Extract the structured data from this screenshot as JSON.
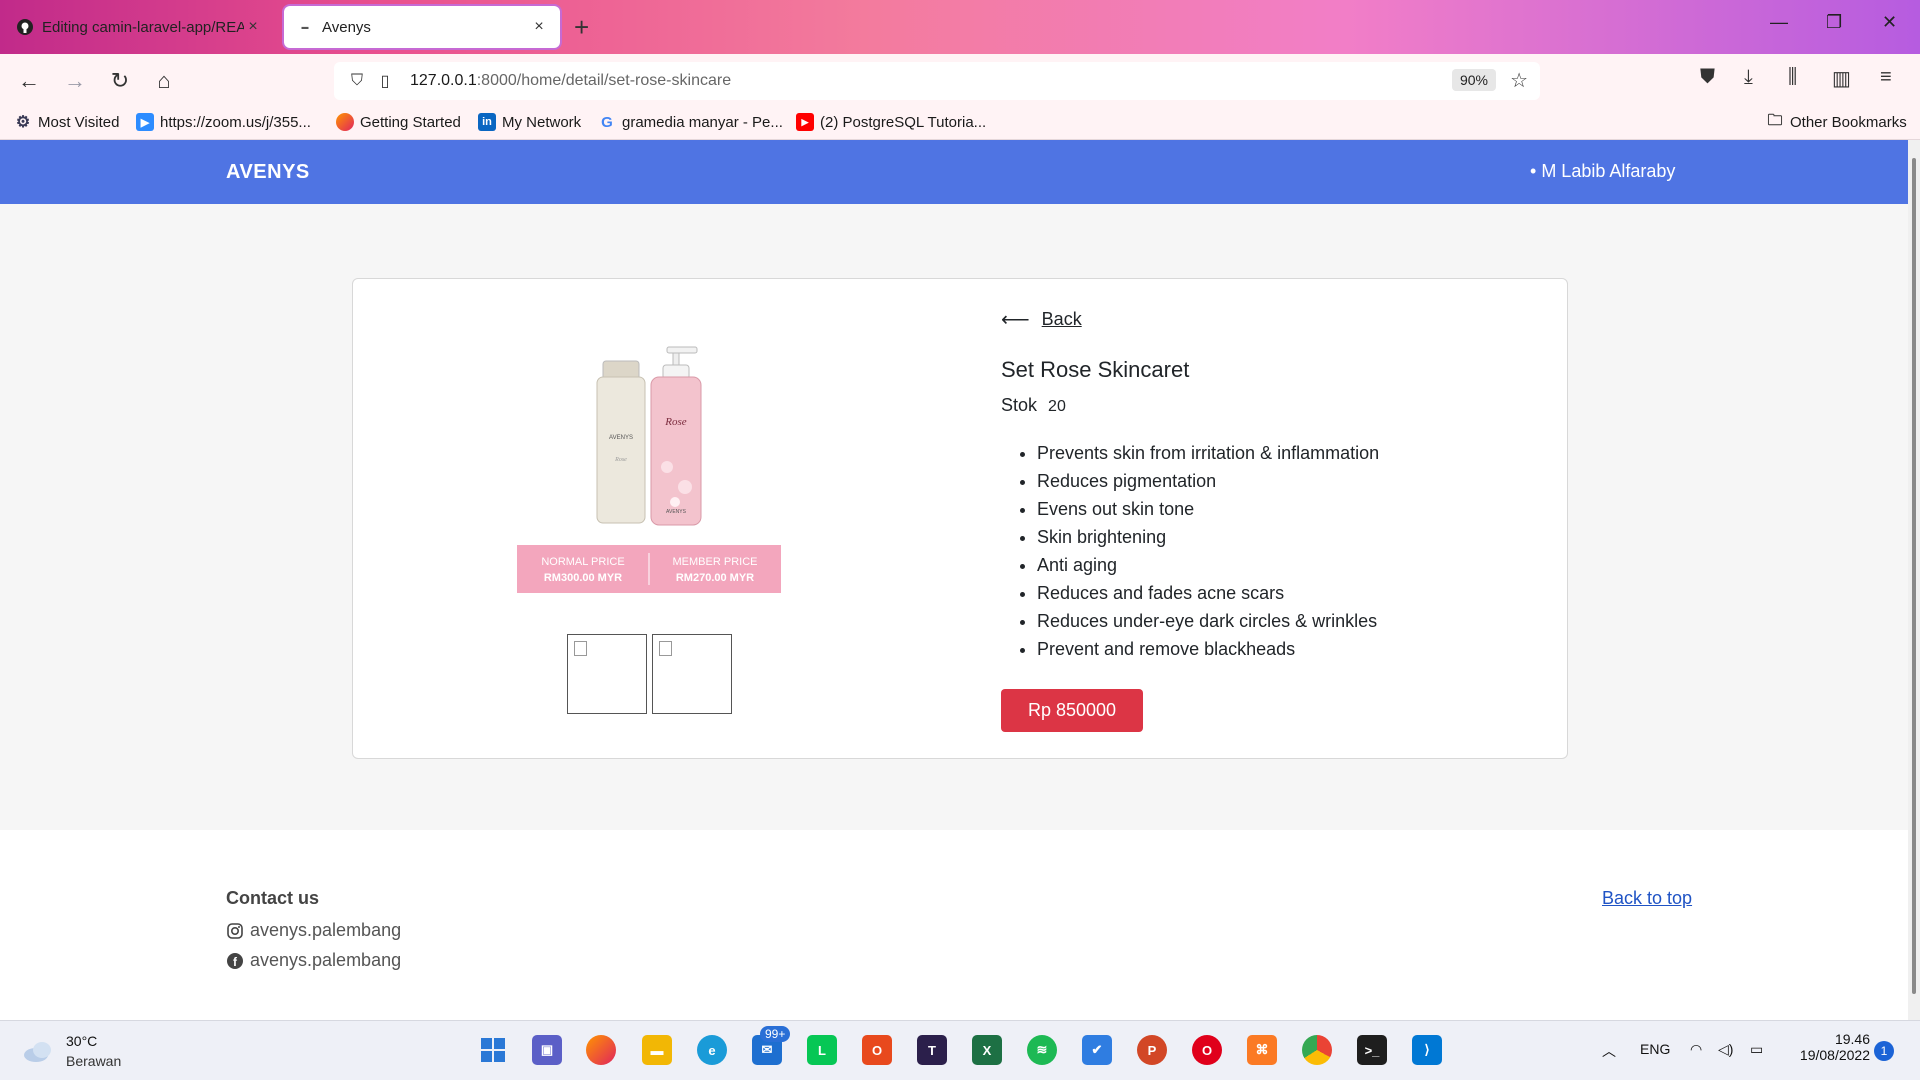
{
  "browser": {
    "tabs": [
      {
        "title": "Editing camin-laravel-app/REA",
        "icon": "github-icon",
        "close": "×"
      },
      {
        "title": "Avenys",
        "icon": "avenys-favicon",
        "close": "×"
      }
    ],
    "new_tab": "+",
    "url": {
      "host": "127.0.0.1",
      "rest": ":8000/home/detail/set-rose-skincare"
    },
    "zoom": "90%",
    "bookmarks": [
      {
        "label": "Most Visited",
        "icon": "gear-icon"
      },
      {
        "label": "https://zoom.us/j/355...",
        "icon": "zoom-icon"
      },
      {
        "label": "Getting Started",
        "icon": "firefox-icon"
      },
      {
        "label": "My Network",
        "icon": "linkedin-icon"
      },
      {
        "label": "gramedia manyar - Pe...",
        "icon": "google-icon"
      },
      {
        "label": "(2) PostgreSQL Tutoria...",
        "icon": "youtube-icon"
      }
    ],
    "other_bookmarks": "Other Bookmarks"
  },
  "site": {
    "brand": "AVENYS",
    "user": "M Labib Alfaraby"
  },
  "product": {
    "back_label": "Back",
    "name": "Set Rose Skincaret",
    "stock_label": "Stok",
    "stock_value": "20",
    "features": [
      "Prevents skin from irritation & inflammation",
      "Reduces pigmentation",
      "Evens out skin tone",
      "Skin brightening",
      "Anti aging",
      "Reduces and fades acne scars",
      "Reduces under-eye dark circles & wrinkles",
      "Prevent and remove blackheads"
    ],
    "price_button": "Rp 850000",
    "image": {
      "left_bottle_brand": "AVENYS",
      "left_bottle_text": "Rose",
      "right_bottle_script": "Rose",
      "right_bottle_brand": "AVENYS",
      "normal_price_label": "NORMAL PRICE",
      "normal_price_value": "RM300.00 MYR",
      "member_price_label": "MEMBER PRICE",
      "member_price_value": "RM270.00 MYR"
    }
  },
  "footer": {
    "contact_heading": "Contact us",
    "instagram": "avenys.palembang",
    "facebook": "avenys.palembang",
    "back_to_top": "Back to top"
  },
  "taskbar": {
    "temperature": "30°C",
    "condition": "Berawan",
    "mail_badge": "99+",
    "language": "ENG",
    "time": "19.46",
    "date": "19/08/2022",
    "notification_count": "1"
  },
  "colors": {
    "navbar": "#4f74e3",
    "price_button": "#dc3545",
    "price_banner": "#f3a6bd",
    "link": "#1f53c5"
  }
}
